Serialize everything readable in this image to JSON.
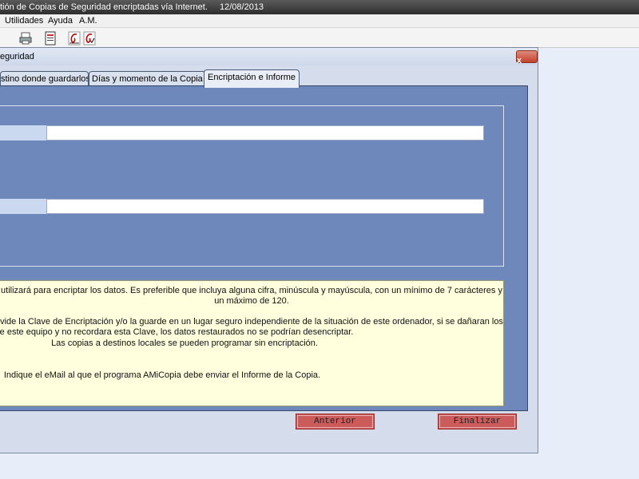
{
  "window": {
    "title": "tión de Copias de Seguridad encriptadas vía Internet.",
    "date": "12/08/2013"
  },
  "menu": {
    "items": [
      "Utilidades",
      "Ayuda",
      "A.M."
    ]
  },
  "toolbar": {
    "icons": [
      "printer-icon",
      "report-icon",
      "signature-icon",
      "signature-check-icon"
    ]
  },
  "dialog": {
    "title": "eguridad",
    "close": "x",
    "tabs": [
      {
        "label": "stino donde guardarlos",
        "active": false
      },
      {
        "label": "Días y momento de la Copia",
        "active": false
      },
      {
        "label": "Encriptación e Informe",
        "active": true
      }
    ],
    "fields": [
      {
        "value": ""
      },
      {
        "value": ""
      }
    ],
    "info": {
      "lines": [
        "utilizará para encriptar los datos.  Es preferible que incluya alguna cifra, minúscula y mayúscula, con un mínimo de 7 carácteres y",
        "un máximo de 120.",
        "vide la Clave de Encriptación y/o la guarde en un lugar seguro independiente de la situación de este ordenador, si se dañaran los",
        "datos de este equipo y no recordara esta Clave, los datos restaurados no se podrían desencriptar.",
        "Las copias a destinos locales se pueden programar sin encriptación.",
        "Indique el eMail al que el programa AMiCopia debe enviar el Informe de la Copia."
      ]
    },
    "buttons": {
      "previous": "Anterior",
      "finish": "Finalizar"
    }
  }
}
